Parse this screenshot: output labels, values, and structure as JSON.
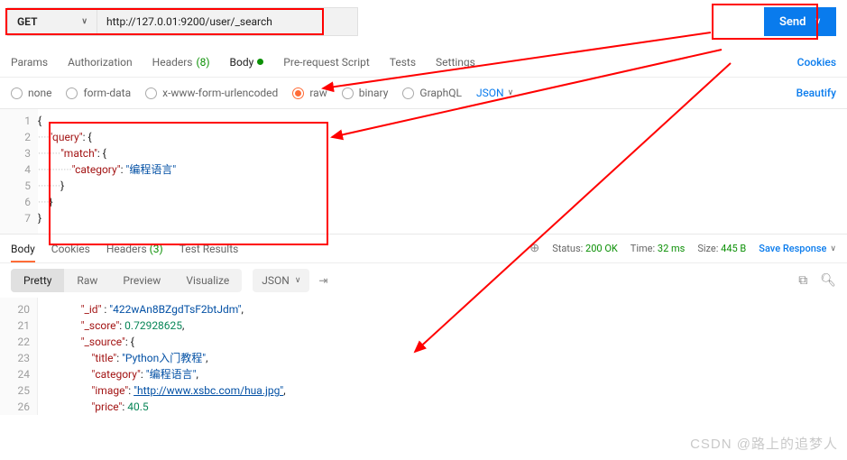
{
  "request": {
    "method": "GET",
    "url": "http://127.0.01:9200/user/_search",
    "send_label": "Send"
  },
  "tabs": {
    "items": [
      "Params",
      "Authorization",
      "Headers",
      "Body",
      "Pre-request Script",
      "Tests",
      "Settings"
    ],
    "headers_count": "(8)",
    "cookies_link": "Cookies"
  },
  "body_format": {
    "opts": [
      "none",
      "form-data",
      "x-www-form-urlencoded",
      "raw",
      "binary",
      "GraphQL"
    ],
    "lang": "JSON",
    "beautify": "Beautify"
  },
  "request_body_lines": [
    "{",
    "    \"query\": {",
    "        \"match\": {",
    "            \"category\": \"编程语言\"",
    "        }",
    "    }",
    "}"
  ],
  "response": {
    "tabs": [
      "Body",
      "Cookies",
      "Headers",
      "Test Results"
    ],
    "headers_count": "(3)",
    "status_label": "Status:",
    "status_value": "200 OK",
    "time_label": "Time:",
    "time_value": "32 ms",
    "size_label": "Size:",
    "size_value": "445 B",
    "save": "Save Response",
    "views": [
      "Pretty",
      "Raw",
      "Preview",
      "Visualize"
    ],
    "lang": "JSON"
  },
  "response_lines": [
    {
      "n": 20,
      "indent": 16,
      "html": "<span class='key'>\"_id\"</span> : <span class='str'>\"422wAn8BZgdTsF2btJdm\"</span>,"
    },
    {
      "n": 21,
      "indent": 16,
      "html": "<span class='key'>\"_score\"</span>: <span class='num'>0.72928625</span>,"
    },
    {
      "n": 22,
      "indent": 16,
      "html": "<span class='key'>\"_source\"</span>: {"
    },
    {
      "n": 23,
      "indent": 20,
      "html": "<span class='key'>\"title\"</span>: <span class='str'>\"Python入门教程\"</span>,"
    },
    {
      "n": 24,
      "indent": 20,
      "html": "<span class='key'>\"category\"</span>: <span class='str'>\"编程语言\"</span>,"
    },
    {
      "n": 25,
      "indent": 20,
      "html": "<span class='key'>\"image\"</span>: <span class='url-str'>\"http://www.xsbc.com/hua.jpg\"</span>,"
    },
    {
      "n": 26,
      "indent": 20,
      "html": "<span class='key'>\"price\"</span>: <span class='num'>40.5</span>"
    }
  ],
  "watermark": "CSDN @路上的追梦人"
}
